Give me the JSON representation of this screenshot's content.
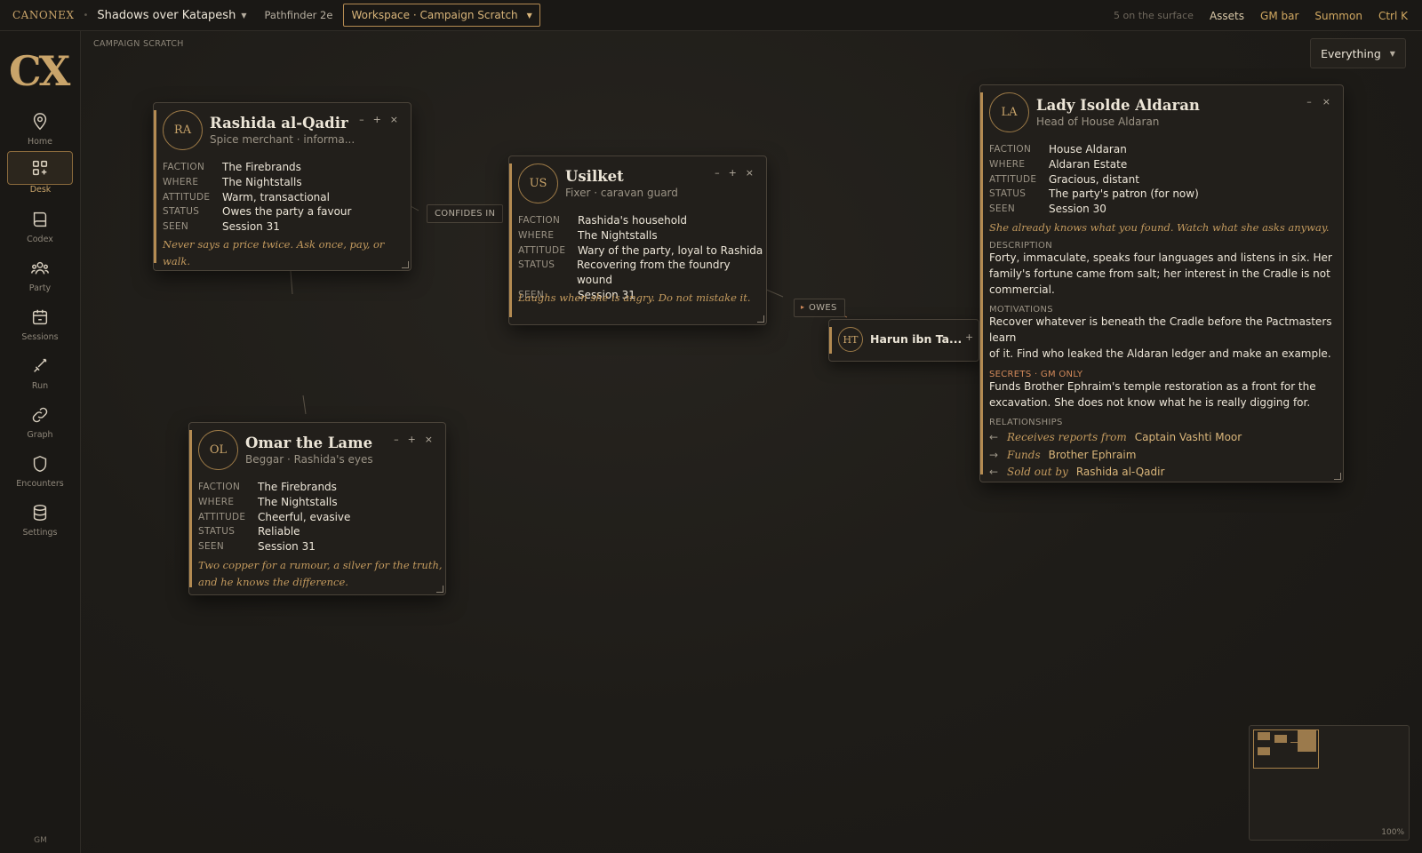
{
  "topbar": {
    "brand": "CANONEX",
    "campaign": "Shadows over Katapesh",
    "system": "Pathfinder 2e",
    "workspace": "Workspace · Campaign Scratch",
    "surface_count": "5 on the surface",
    "links": [
      "Assets",
      "GM bar",
      "Summon",
      "Ctrl K"
    ]
  },
  "sidebar": {
    "logo": "CX",
    "items": [
      {
        "label": "Home",
        "icon": "map-pin-icon"
      },
      {
        "label": "Desk",
        "icon": "grid-plus-icon",
        "active": true
      },
      {
        "label": "Codex",
        "icon": "book-icon"
      },
      {
        "label": "Party",
        "icon": "users-icon"
      },
      {
        "label": "Sessions",
        "icon": "calendar-icon"
      },
      {
        "label": "Run",
        "icon": "sword-icon"
      },
      {
        "label": "Graph",
        "icon": "link-icon"
      },
      {
        "label": "Encounters",
        "icon": "shield-icon"
      },
      {
        "label": "Settings",
        "icon": "database-icon"
      }
    ],
    "footer": "GM"
  },
  "canvas": {
    "breadcrumb": "CAMPAIGN SCRATCH",
    "filter": "Everything",
    "edge_labels": [
      "CONFIDES IN",
      "OWES"
    ],
    "zoom": "100%"
  },
  "cards": {
    "rashida": {
      "initials": "RA",
      "name": "Rashida al-Qadir",
      "subtitle": "Spice merchant · informa...",
      "fields": [
        {
          "label": "FACTION",
          "value": "The Firebrands"
        },
        {
          "label": "WHERE",
          "value": "The Nightstalls"
        },
        {
          "label": "ATTITUDE",
          "value": "Warm, transactional"
        },
        {
          "label": "STATUS",
          "value": "Owes the party a favour"
        },
        {
          "label": "SEEN",
          "value": "Session 31"
        }
      ],
      "quote": "Never says a price twice. Ask once, pay, or walk."
    },
    "usilket": {
      "initials": "US",
      "name": "Usilket",
      "subtitle": "Fixer · caravan guard",
      "fields": [
        {
          "label": "FACTION",
          "value": "Rashida's household"
        },
        {
          "label": "WHERE",
          "value": "The Nightstalls"
        },
        {
          "label": "ATTITUDE",
          "value": "Wary of the party, loyal to Rashida"
        },
        {
          "label": "STATUS",
          "value": "Recovering from the foundry wound"
        },
        {
          "label": "SEEN",
          "value": "Session 31"
        }
      ],
      "quote": "Laughs when she is angry. Do not mistake it."
    },
    "omar": {
      "initials": "OL",
      "name": "Omar the Lame",
      "subtitle": "Beggar · Rashida's eyes",
      "fields": [
        {
          "label": "FACTION",
          "value": "The Firebrands"
        },
        {
          "label": "WHERE",
          "value": "The Nightstalls"
        },
        {
          "label": "ATTITUDE",
          "value": "Cheerful, evasive"
        },
        {
          "label": "STATUS",
          "value": "Reliable"
        },
        {
          "label": "SEEN",
          "value": "Session 31"
        }
      ],
      "quote_lines": [
        "Two copper for a rumour, a silver for the truth,",
        "and he knows the difference."
      ]
    },
    "harun": {
      "initials": "HT",
      "name": "Harun ibn Ta..."
    },
    "isolde": {
      "initials": "LA",
      "name": "Lady Isolde Aldaran",
      "subtitle": "Head of House Aldaran",
      "fields": [
        {
          "label": "FACTION",
          "value": "House Aldaran"
        },
        {
          "label": "WHERE",
          "value": "Aldaran Estate"
        },
        {
          "label": "ATTITUDE",
          "value": "Gracious, distant"
        },
        {
          "label": "STATUS",
          "value": "The party's patron (for now)"
        },
        {
          "label": "SEEN",
          "value": "Session 30"
        }
      ],
      "quote": "She already knows what you found. Watch what she asks anyway.",
      "description_label": "DESCRIPTION",
      "description_lines": [
        "Forty, immaculate, speaks four languages and listens in six. Her",
        "family's fortune came from salt; her interest in the Cradle is not",
        "commercial."
      ],
      "motivations_label": "MOTIVATIONS",
      "motivations_lines": [
        "Recover whatever is beneath the Cradle before the Pactmasters learn",
        "of it. Find who leaked the Aldaran ledger and make an example."
      ],
      "secrets_label": "SECRETS · GM ONLY",
      "secrets_lines": [
        "Funds Brother Ephraim's temple restoration as a front for the",
        "excavation. She does not know what he is really digging for."
      ],
      "relationships_label": "RELATIONSHIPS",
      "relationships": [
        {
          "arrow": "←",
          "verb": "Receives reports from",
          "name": "Captain Vashti Moor"
        },
        {
          "arrow": "→",
          "verb": "Funds",
          "name": "Brother Ephraim"
        },
        {
          "arrow": "←",
          "verb": "Sold out by",
          "name": "Rashida al-Qadir"
        }
      ]
    }
  },
  "card_controls": {
    "minimize": "–",
    "expand": "+",
    "close": "×"
  },
  "colors": {
    "accent": "#c9a46a",
    "background": "#1d1b17",
    "card": "#221f1b",
    "secret": "#d1895a"
  }
}
